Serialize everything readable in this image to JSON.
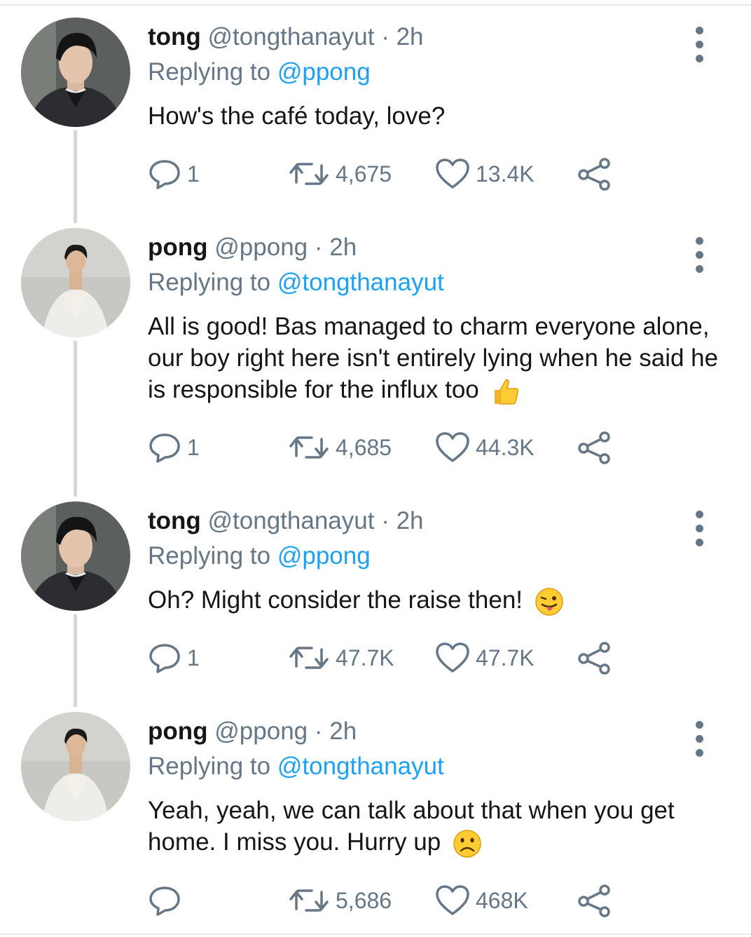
{
  "tweets": [
    {
      "name": "tong",
      "handle": "@tongthanayut",
      "dot": "·",
      "time": "2h",
      "replying_label": "Replying to",
      "replying_to": "@ppong",
      "text": "How's the café today, love?",
      "emoji": "",
      "replies": "1",
      "retweets": "4,675",
      "likes": "13.4K"
    },
    {
      "name": "pong",
      "handle": "@ppong",
      "dot": "·",
      "time": "2h",
      "replying_label": "Replying to",
      "replying_to": "@tongthanayut",
      "text": "All is good! Bas managed to charm everyone alone, our boy right here isn't entirely lying when he said he is responsible for the influx too",
      "emoji": "thumbs-up",
      "replies": "1",
      "retweets": "4,685",
      "likes": "44.3K"
    },
    {
      "name": "tong",
      "handle": "@tongthanayut",
      "dot": "·",
      "time": "2h",
      "replying_label": "Replying to",
      "replying_to": "@ppong",
      "text": "Oh? Might consider the raise then!",
      "emoji": "winking-tongue",
      "replies": "1",
      "retweets": "47.7K",
      "likes": "47.7K"
    },
    {
      "name": "pong",
      "handle": "@ppong",
      "dot": "·",
      "time": "2h",
      "replying_label": "Replying to",
      "replying_to": "@tongthanayut",
      "text": "Yeah, yeah, we can talk about that when you get home. I miss you. Hurry up",
      "emoji": "slightly-frowning",
      "replies": "",
      "retweets": "5,686",
      "likes": "468K"
    }
  ],
  "colors": {
    "text": "#14171a",
    "secondary": "#657786",
    "link": "#1da1f2",
    "thread_line": "#d2d7db"
  },
  "icons": [
    "reply-icon",
    "retweet-icon",
    "like-icon",
    "share-icon",
    "more-options-icon"
  ]
}
